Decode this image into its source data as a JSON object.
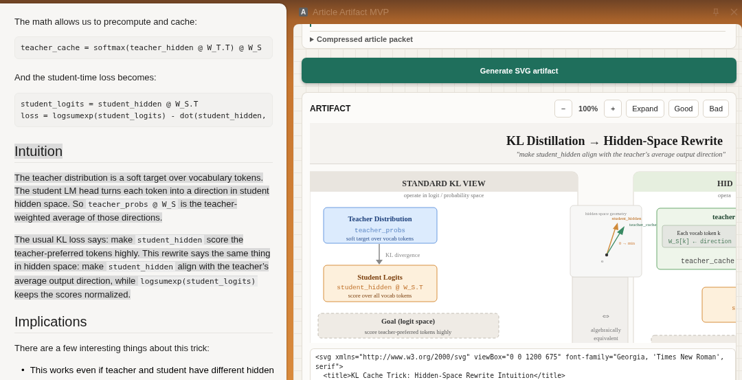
{
  "article": {
    "blocks": [
      {
        "kind": "para",
        "highlighted": false,
        "segments": [
          {
            "kind": "text",
            "text": "The math allows us to precompute and cache:"
          }
        ]
      },
      {
        "kind": "code",
        "lines": [
          "teacher_cache = softmax(teacher_hidden @ W_T.T) @ W_S"
        ]
      },
      {
        "kind": "para",
        "highlighted": false,
        "segments": [
          {
            "kind": "text",
            "text": "And the student-time loss becomes:"
          }
        ]
      },
      {
        "kind": "code",
        "lines": [
          "student_logits = student_hidden @ W_S.T",
          "loss = logsumexp(student_logits) - dot(student_hidden,"
        ]
      },
      {
        "kind": "heading",
        "highlighted": true,
        "text": "Intuition"
      },
      {
        "kind": "para",
        "highlighted": true,
        "segments": [
          {
            "kind": "text",
            "text": "The teacher distribution is a soft target over vocabulary tokens. The student LM head turns each token into a direction in student hidden space. So "
          },
          {
            "kind": "code",
            "text": "teacher_probs @ W_S"
          },
          {
            "kind": "text",
            "text": " is the teacher-weighted average of those directions."
          }
        ]
      },
      {
        "kind": "para",
        "highlighted": true,
        "segments": [
          {
            "kind": "text",
            "text": "The usual KL loss says: make "
          },
          {
            "kind": "code",
            "text": "student_hidden"
          },
          {
            "kind": "text",
            "text": " score the teacher-preferred tokens highly. This rewrite says the same thing in hidden space: make "
          },
          {
            "kind": "code",
            "text": "student_hidden"
          },
          {
            "kind": "text",
            "text": " align with the teacher’s average output direction, while "
          },
          {
            "kind": "code",
            "text": "logsumexp(student_logits)"
          },
          {
            "kind": "text",
            "text": " keeps the scores normalized."
          }
        ]
      },
      {
        "kind": "heading",
        "highlighted": false,
        "text": "Implications"
      },
      {
        "kind": "para",
        "highlighted": false,
        "segments": [
          {
            "kind": "text",
            "text": "There are a few interesting things about this trick:"
          }
        ]
      },
      {
        "kind": "list",
        "items": [
          {
            "marker": "•",
            "text": "This works even if teacher and student have different hidden"
          }
        ]
      }
    ]
  },
  "window": {
    "icon_letter": "A",
    "title": "Article Artifact MVP"
  },
  "packet": {
    "label": "Compressed article packet",
    "expanded": false
  },
  "generate_button": "Generate SVG artifact",
  "artifact": {
    "heading": "ARTIFACT",
    "zoom": "100%",
    "controls": [
      {
        "kind": "zoom-out",
        "label": "−"
      },
      {
        "kind": "readout"
      },
      {
        "kind": "zoom-in",
        "label": "+"
      },
      {
        "kind": "button",
        "label": "Expand"
      },
      {
        "kind": "button",
        "label": "Good"
      },
      {
        "kind": "button",
        "label": "Bad"
      }
    ]
  },
  "diagram": {
    "title": "KL Distillation → Hidden-Space Rewrite",
    "subtitle": "\"make student_hidden align with the teacher's average output direction\"",
    "left_view": {
      "title": "STANDARD KL VIEW",
      "subtitle": "operate in logit / probability space"
    },
    "teacher_box": {
      "title": "Teacher Distribution",
      "code": "teacher_probs",
      "note": "soft target over vocab tokens"
    },
    "edge_label": "KL divergence",
    "student_box": {
      "title": "Student Logits",
      "code": "student_hidden @ W_S.T",
      "note": "score over all vocab tokens"
    },
    "goal_box": {
      "title": "Goal (logit space)",
      "note": "score teacher-preferred tokens highly"
    },
    "geometry": {
      "caption": "hidden space geometry",
      "vector_a": "student_hidden",
      "vector_b": "teacher_cache",
      "angle": "θ → min",
      "origin": "o"
    },
    "equivalence": {
      "symbol": "⇔",
      "lines": [
        "algebraically",
        "equivalent"
      ]
    },
    "right_view": {
      "title": "HID",
      "subtitle": "opera"
    },
    "cache_box": {
      "title": "teacher",
      "inner_title": "Each vocab token k",
      "inner_code": "W_S[k] ← direction",
      "code": "teacher_cache"
    },
    "orange_box": {
      "code": "s"
    }
  },
  "source": {
    "lines": [
      "<svg xmlns=\"http://www.w3.org/2000/svg\" viewBox=\"0 0 1200 675\" font-family=\"Georgia, 'Times New Roman',",
      "serif\">",
      "  <title>KL Cache Trick: Hidden-Space Rewrite Intuition</title>"
    ]
  }
}
